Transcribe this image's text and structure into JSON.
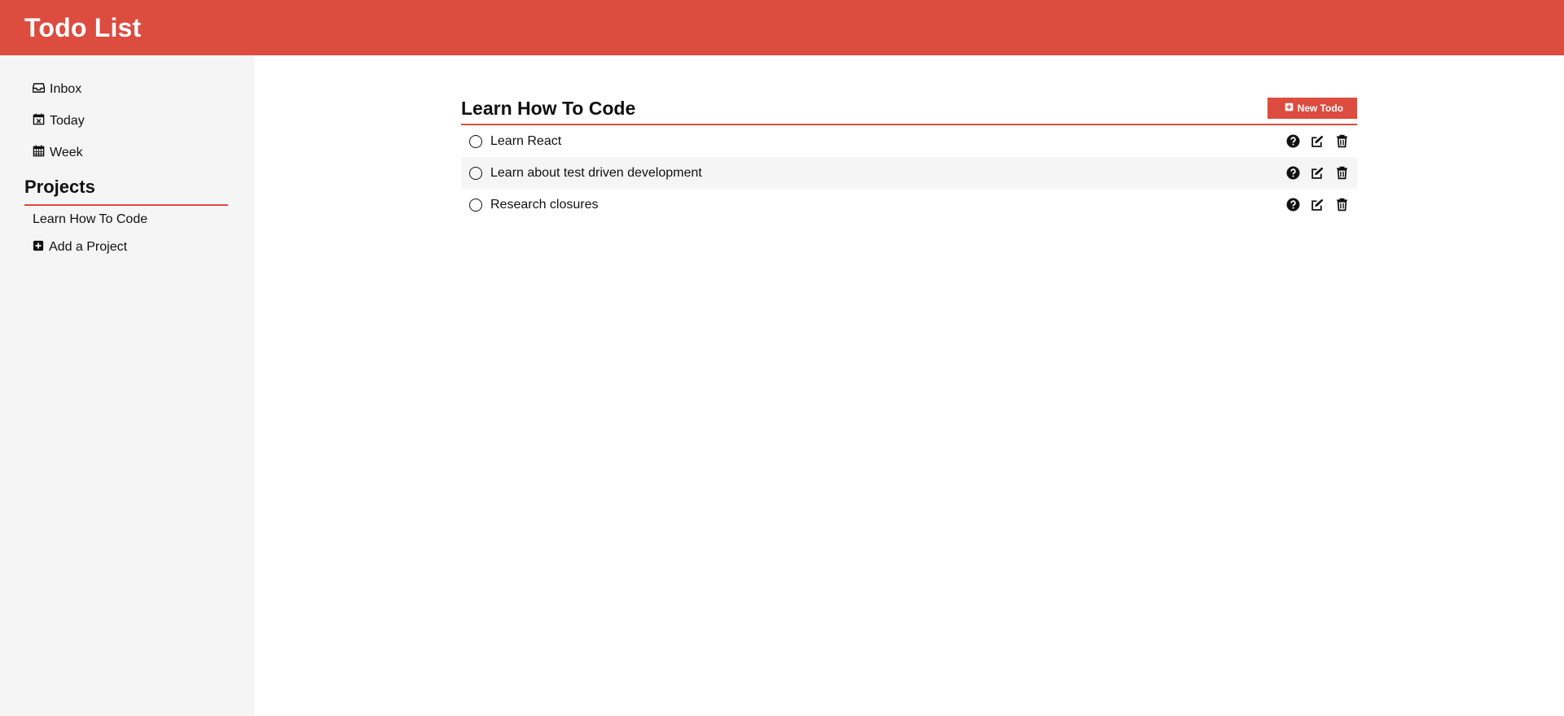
{
  "app": {
    "title": "Todo List"
  },
  "colors": {
    "accent": "#dc4c3f",
    "sidebar_bg": "#f5f5f5"
  },
  "sidebar": {
    "nav": [
      {
        "label": "Inbox",
        "icon": "inbox-icon"
      },
      {
        "label": "Today",
        "icon": "calendar-day-icon"
      },
      {
        "label": "Week",
        "icon": "calendar-week-icon"
      }
    ],
    "projects_title": "Projects",
    "projects": [
      {
        "label": "Learn How To Code"
      }
    ],
    "add_project_label": "Add a Project"
  },
  "main": {
    "title": "Learn How To Code",
    "new_todo_label": "New Todo",
    "todos": [
      {
        "text": "Learn React"
      },
      {
        "text": "Learn about test driven development"
      },
      {
        "text": "Research closures"
      }
    ]
  }
}
